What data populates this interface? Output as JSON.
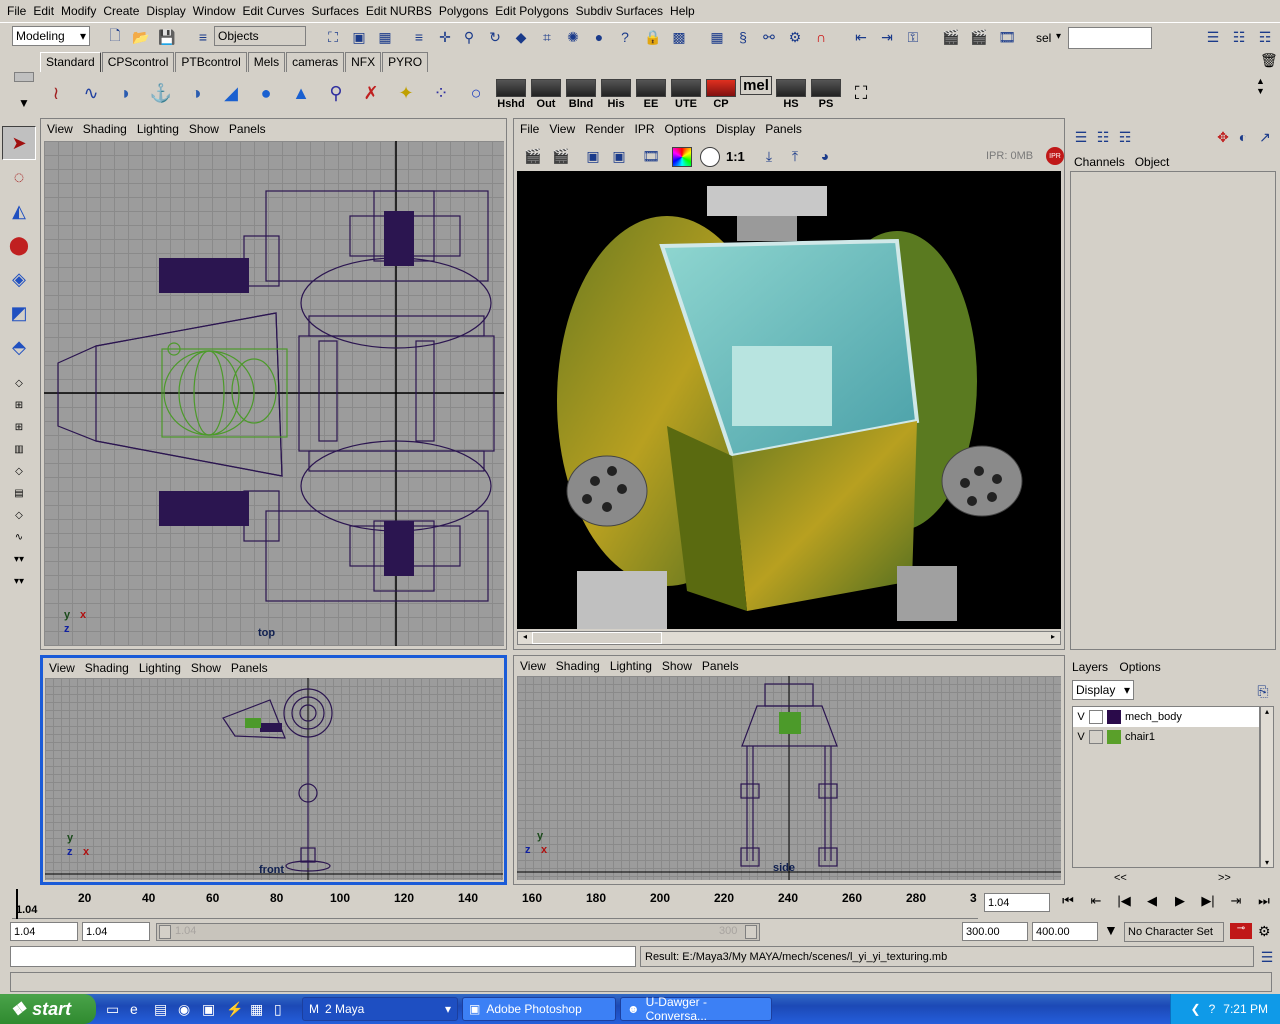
{
  "menus": [
    "File",
    "Edit",
    "Modify",
    "Create",
    "Display",
    "Window",
    "Edit Curves",
    "Surfaces",
    "Edit NURBS",
    "Polygons",
    "Edit Polygons",
    "Subdiv Surfaces",
    "Help"
  ],
  "status": {
    "menu_set": "Modeling",
    "selection_mode": "Objects",
    "sel_label": "sel"
  },
  "shelf_tabs": [
    "Standard",
    "CPScontrol",
    "PTBcontrol",
    "Mels",
    "cameras",
    "NFX",
    "PYRO"
  ],
  "shelf_text_buttons": [
    "Hshd",
    "Out",
    "Blnd",
    "His",
    "EE",
    "UTE",
    "CP",
    "HS",
    "PS"
  ],
  "shelf_mel_label": "mel",
  "panel_menu": [
    "View",
    "Shading",
    "Lighting",
    "Show",
    "Panels"
  ],
  "render_menu": [
    "File",
    "View",
    "Render",
    "IPR",
    "Options",
    "Display",
    "Panels"
  ],
  "render": {
    "ipr_text": "IPR: 0MB",
    "ratio": "1:1",
    "ipr_badge": "IPR"
  },
  "viewports": {
    "top": "top",
    "front": "front",
    "side": "side"
  },
  "axes": {
    "x": "x",
    "y": "y",
    "z": "z"
  },
  "channels": {
    "tabs": [
      "Channels",
      "Object"
    ]
  },
  "layers": {
    "tabs": [
      "Layers",
      "Options"
    ],
    "display": "Display",
    "items": [
      {
        "vis": "V",
        "name": "mech_body",
        "color": "#2a0a4a"
      },
      {
        "vis": "V",
        "name": "chair1",
        "color": "#5aa02a"
      }
    ],
    "nav_left": "<<",
    "nav_right": ">>"
  },
  "timeline": {
    "ticks": [
      "20",
      "40",
      "60",
      "80",
      "100",
      "120",
      "140",
      "160",
      "180",
      "200",
      "220",
      "240",
      "260",
      "280",
      "3"
    ],
    "current": "1.04",
    "frame_field": "1.04"
  },
  "range": {
    "start": "1.04",
    "start2": "1.04",
    "slider_start": "1.04",
    "slider_end": "300",
    "end": "300.00",
    "end2": "400.00",
    "character_set": "No Character Set"
  },
  "result": "Result: E:/Maya3/My MAYA/mech/scenes/l_yi_yi_texturing.mb",
  "taskbar": {
    "start": "start",
    "tasks": [
      "2 Maya",
      "Adobe Photoshop",
      "U-Dawger - Conversa..."
    ],
    "time": "7:21 PM"
  },
  "colors": {
    "wire": "#2b1550",
    "green": "#4c9a2a",
    "active_border": "#1a5bd8"
  }
}
